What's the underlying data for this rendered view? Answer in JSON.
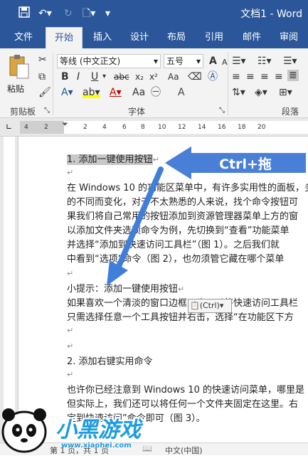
{
  "title_bar": {
    "doc_title": "文档1 - Word"
  },
  "tabs": [
    "文件",
    "开始",
    "插入",
    "设计",
    "布局",
    "引用",
    "邮件",
    "审阅"
  ],
  "ribbon": {
    "paste_label": "粘贴",
    "font_name": "等线 (中文正文)",
    "font_size": "五号",
    "groups": {
      "clipboard": "剪贴板",
      "font": "字体",
      "paragraph": "段落"
    },
    "font_buttons": [
      "B",
      "I",
      "U",
      "abc",
      "x₂",
      "x²"
    ],
    "size_buttons": [
      "A",
      "A",
      "Aa",
      "A"
    ]
  },
  "ruler_numbers": [
    "4",
    "2",
    "",
    "2",
    "4",
    "6",
    "8",
    "10",
    "12",
    "14",
    "16",
    "18",
    "20"
  ],
  "callout": {
    "text": "Ctrl+拖"
  },
  "paste_tag": {
    "label": "(Ctrl)"
  },
  "document": {
    "lines": [
      "1. 添加一键使用按钮",
      "",
      "在 Windows 10 的功能区菜单中，有许多实用性的面板，多",
      "的不同而变化，对于不太熟悉的人来说，找个命令按钮可",
      "果我们将自己常用的按钮添加到资源管理器菜单上方的窗",
      "以添加文件夹选项命令为例，先切换到“查看”功能菜单",
      "并选择“添加到快速访问工具栏”（图 1）。之后我们就",
      "中看到“选项”命令（图 2），也勿须管它藏在哪个菜单",
      "",
      "小提示：添加一键使用按钮",
      "如果喜欢一个清淡的窗口边框，也可以将快速访问工具栏",
      "只需选择任意一个工具按钮并右击，选择“在功能区下方",
      "",
      "",
      "2. 添加右键实用命令",
      "",
      "也许你已经注意到 Windows 10 的快速访问菜单，哪里是",
      "但实际上，我们还可以将任何一个文件夹固定在这里。右",
      "定到快速访问”命令即可（图 3）。"
    ]
  },
  "status_bar": {
    "page": "第 1 页，共 1 页",
    "lang": "中文(中国)"
  },
  "watermark": {
    "text": "小黑游戏",
    "url": "www.xiaohei.com"
  }
}
